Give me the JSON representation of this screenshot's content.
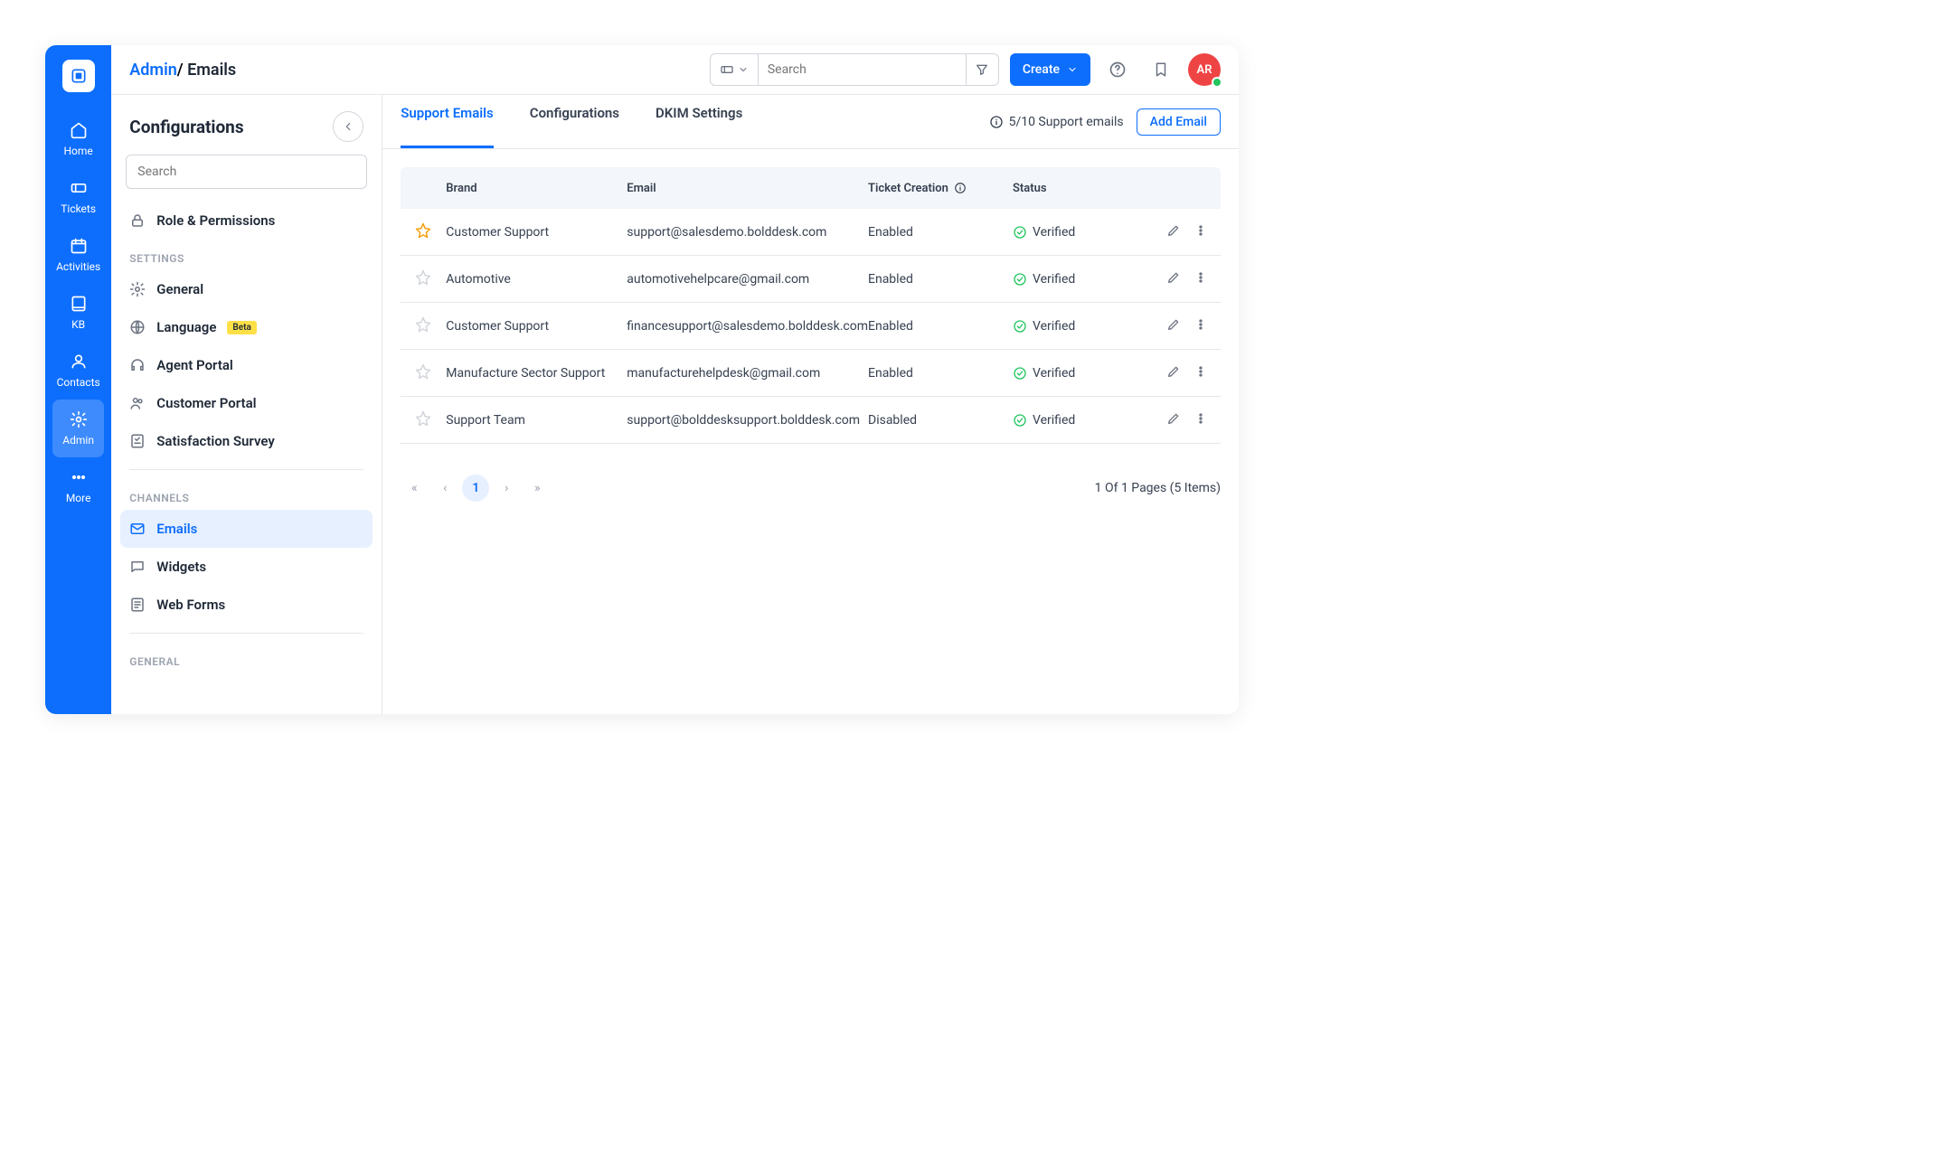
{
  "breadcrumb": {
    "link": "Admin",
    "sep": "/ ",
    "current": "Emails"
  },
  "header": {
    "search_placeholder": "Search",
    "create": "Create",
    "avatar": "AR"
  },
  "sidebar_main": {
    "items": [
      "Home",
      "Tickets",
      "Activities",
      "KB",
      "Contacts",
      "Admin",
      "More"
    ]
  },
  "config": {
    "title": "Configurations",
    "search_placeholder": "Search",
    "role": "Role & Permissions",
    "sections": {
      "settings": "SETTINGS",
      "channels": "CHANNELS",
      "general": "GENERAL"
    },
    "settings": [
      "General",
      "Language",
      "Agent Portal",
      "Customer Portal",
      "Satisfaction Survey"
    ],
    "beta": "Beta",
    "channels": [
      "Emails",
      "Widgets",
      "Web Forms"
    ]
  },
  "tabs": [
    "Support Emails",
    "Configurations",
    "DKIM Settings"
  ],
  "count": "5/10 Support emails",
  "add_email": "Add Email",
  "columns": {
    "brand": "Brand",
    "email": "Email",
    "ticket": "Ticket Creation",
    "status": "Status"
  },
  "rows": [
    {
      "starred": true,
      "brand": "Customer Support",
      "email": "support@salesdemo.bolddesk.com",
      "ticket": "Enabled",
      "status": "Verified"
    },
    {
      "starred": false,
      "brand": "Automotive",
      "email": "automotivehelpcare@gmail.com",
      "ticket": "Enabled",
      "status": "Verified"
    },
    {
      "starred": false,
      "brand": "Customer Support",
      "email": "financesupport@salesdemo.bolddesk.com",
      "ticket": "Enabled",
      "status": "Verified"
    },
    {
      "starred": false,
      "brand": "Manufacture Sector Support",
      "email": "manufacturehelpdesk@gmail.com",
      "ticket": "Enabled",
      "status": "Verified"
    },
    {
      "starred": false,
      "brand": "Support Team",
      "email": "support@bolddesksupport.bolddesk.com",
      "ticket": "Disabled",
      "status": "Verified"
    }
  ],
  "pagination": {
    "current": "1",
    "info": "1 Of 1 Pages (5 Items)"
  }
}
